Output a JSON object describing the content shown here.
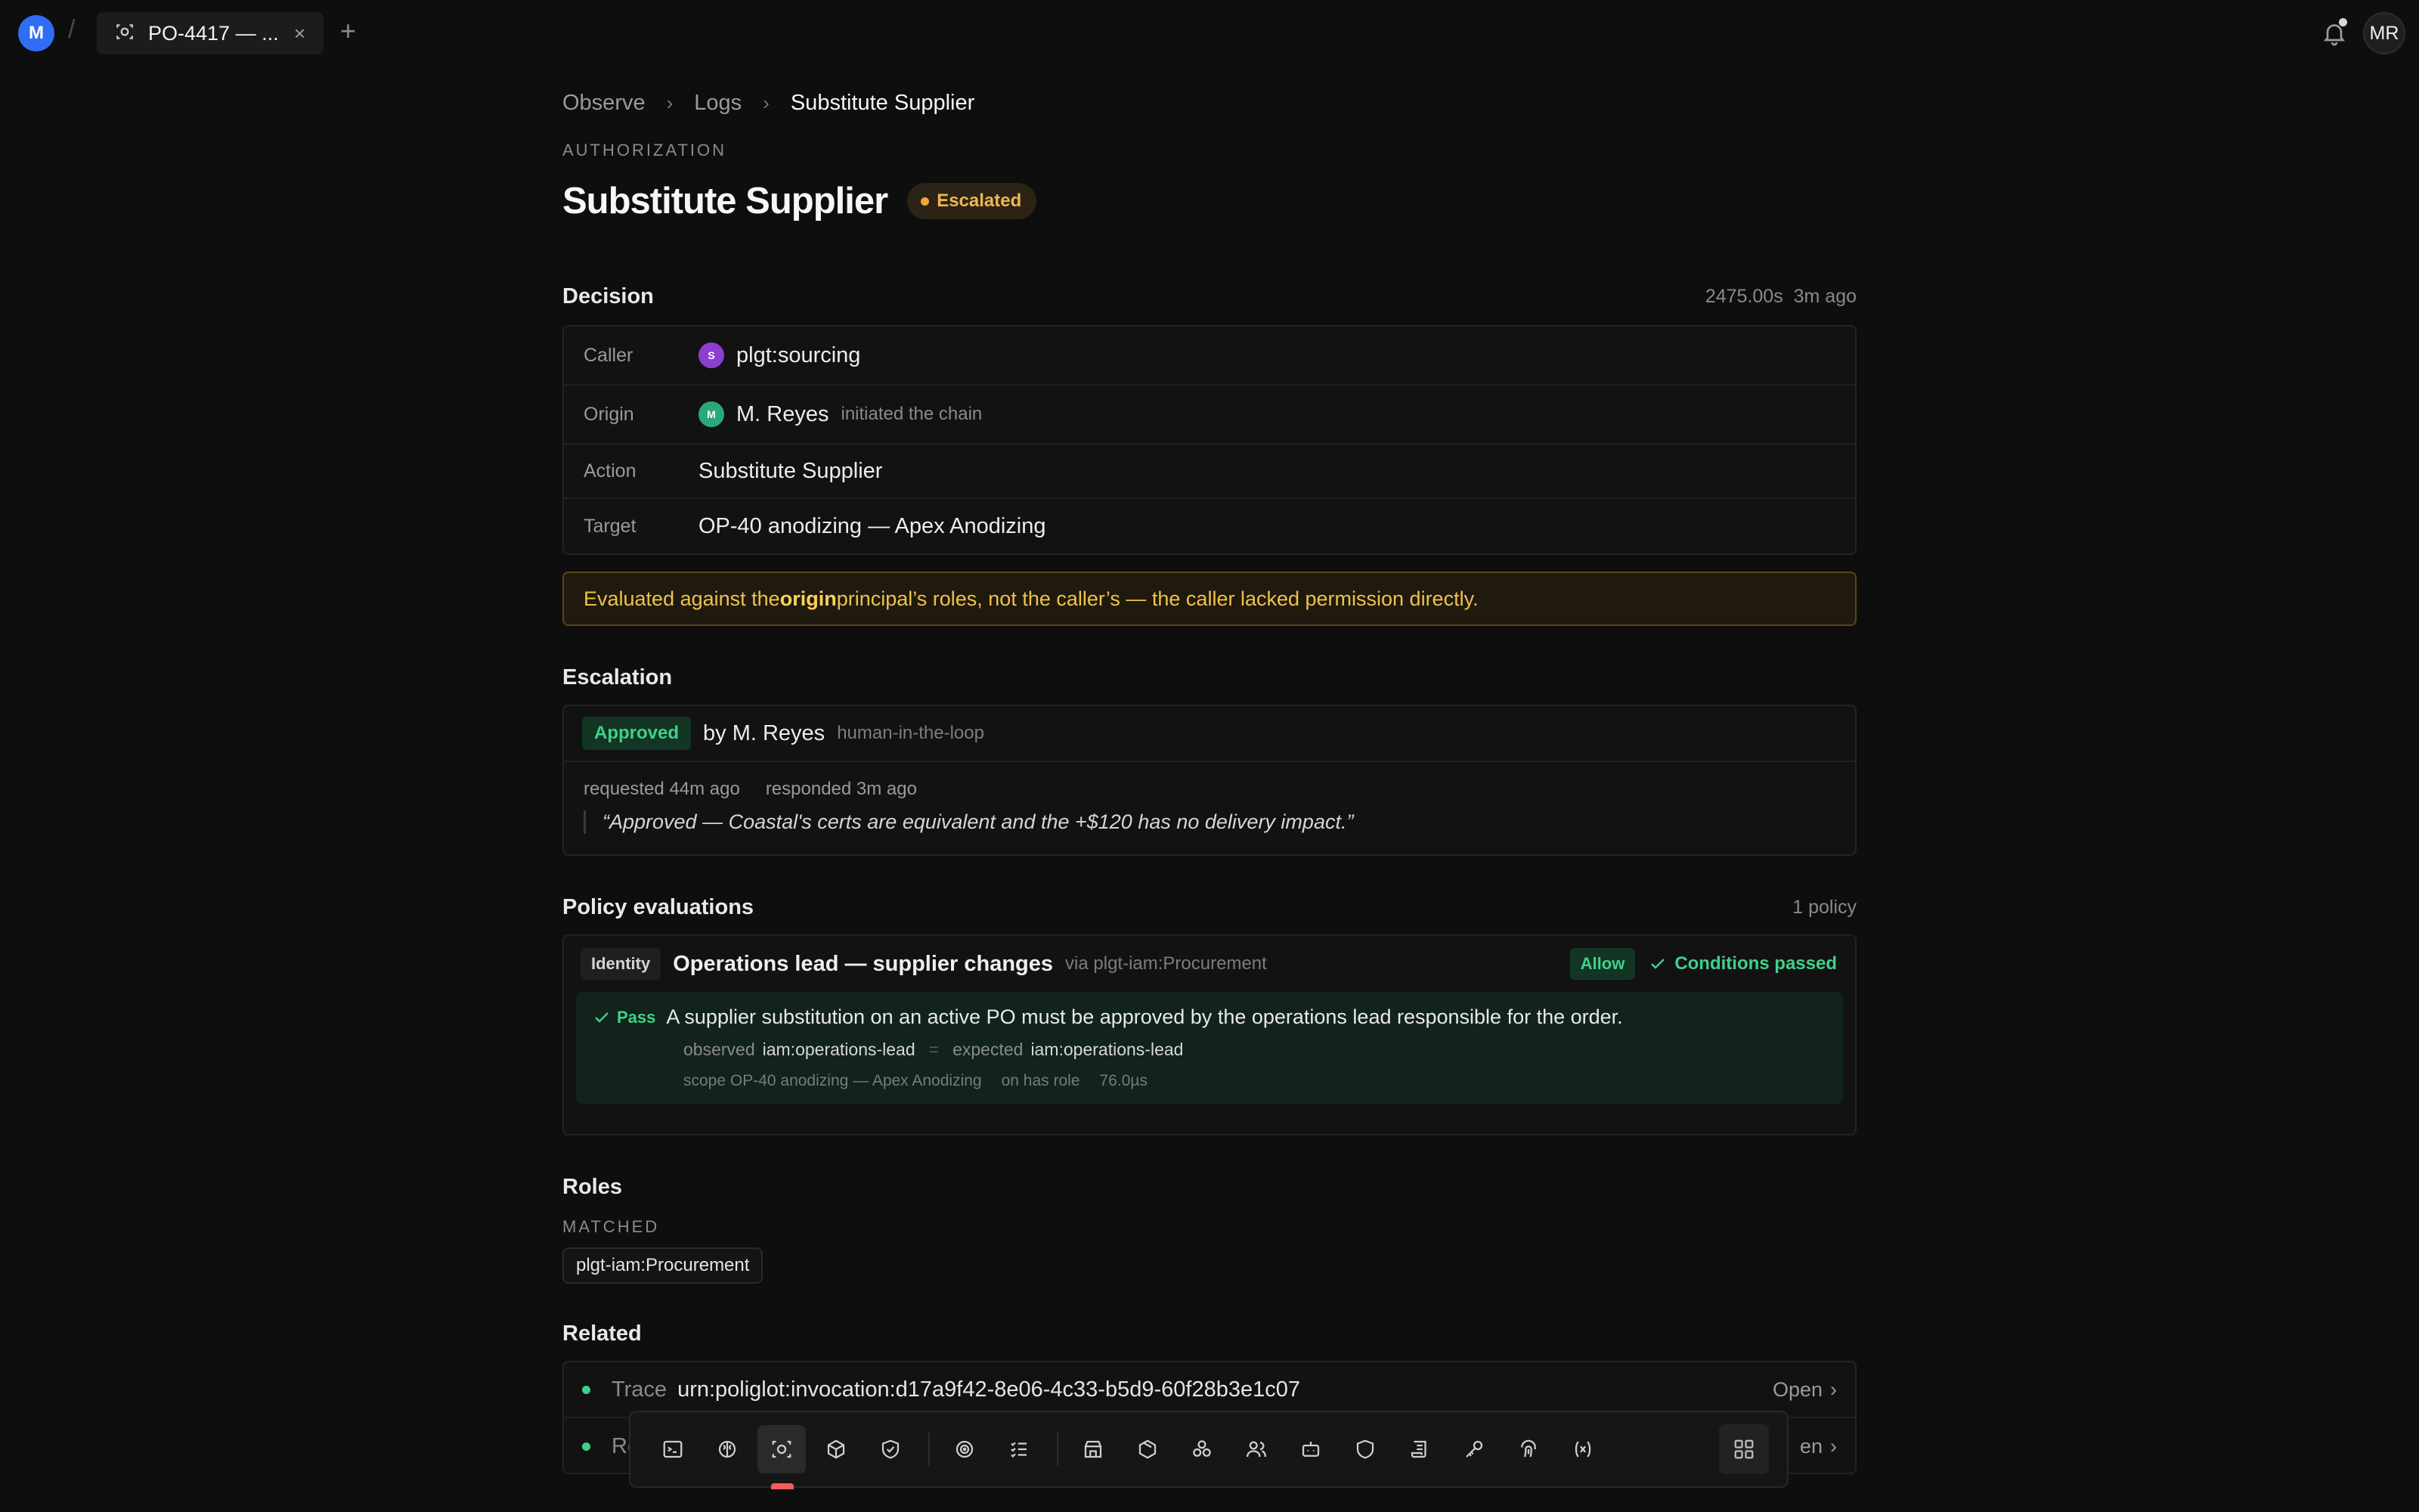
{
  "workspace": {
    "initial": "M"
  },
  "tab": {
    "label": "PO-4417 — ...",
    "close": "×"
  },
  "user": {
    "initials": "MR"
  },
  "breadcrumb": {
    "items": [
      "Observe",
      "Logs",
      "Substitute Supplier"
    ]
  },
  "page": {
    "kicker": "AUTHORIZATION",
    "title": "Substitute Supplier",
    "status": "Escalated"
  },
  "decision": {
    "heading": "Decision",
    "duration": "2475.00s",
    "when": "3m ago",
    "rows": {
      "caller": {
        "key": "Caller",
        "avatar": "S",
        "value": "plgt:sourcing"
      },
      "origin": {
        "key": "Origin",
        "avatar": "M",
        "value": "M. Reyes",
        "note": "initiated the chain"
      },
      "action": {
        "key": "Action",
        "value": "Substitute Supplier"
      },
      "target": {
        "key": "Target",
        "value": "OP-40 anodizing — Apex Anodizing"
      }
    },
    "notice": {
      "pre": "Evaluated against the ",
      "bold": "origin",
      "post": " principal’s roles, not the caller’s — the caller lacked permission directly."
    }
  },
  "escalation": {
    "heading": "Escalation",
    "status": "Approved",
    "by": "by M. Reyes",
    "mode": "human-in-the-loop",
    "requested": "requested 44m ago",
    "responded": "responded 3m ago",
    "quote": "“Approved — Coastal's certs are equivalent and the +$120 has no delivery impact.”"
  },
  "policies": {
    "heading": "Policy evaluations",
    "count": "1 policy",
    "items": [
      {
        "kind": "Identity",
        "name": "Operations lead — supplier changes",
        "via": "via plgt-iam:Procurement",
        "effect": "Allow",
        "conditions": "Conditions passed",
        "result": "Pass",
        "description": "A supplier substitution on an active PO must be approved by the operations lead responsible for the order.",
        "observed_label": "observed",
        "observed": "iam:operations-lead",
        "eq": "=",
        "expected_label": "expected",
        "expected": "iam:operations-lead",
        "scope": "scope OP-40 anodizing — Apex Anodizing",
        "on": "on has role",
        "latency": "76.0µs"
      }
    ]
  },
  "roles": {
    "heading": "Roles",
    "subheading": "MATCHED",
    "matched": [
      "plgt-iam:Procurement"
    ]
  },
  "related": {
    "heading": "Related",
    "items": [
      {
        "kind": "Trace",
        "value": "urn:poliglot:invocation:d17a9f42-8e06-4c33-b5d9-60f28b3e1c07",
        "action": "Open"
      },
      {
        "kind": "Re",
        "value": "",
        "action": "en"
      }
    ]
  },
  "dock": {
    "icons": [
      "terminal-icon",
      "brain-icon",
      "observe-icon",
      "cube-icon",
      "shield-check-icon",
      "target-icon",
      "checklist-icon",
      "store-icon",
      "package-icon",
      "boxes-icon",
      "users-icon",
      "bot-icon",
      "shield-icon",
      "scroll-icon",
      "key-icon",
      "fingerprint-icon",
      "variable-icon",
      "grid-icon"
    ]
  },
  "colors": {
    "accent": "#2f6df6",
    "success": "#3fd18a",
    "warning": "#f2b64a",
    "background": "#0e0e0f"
  }
}
